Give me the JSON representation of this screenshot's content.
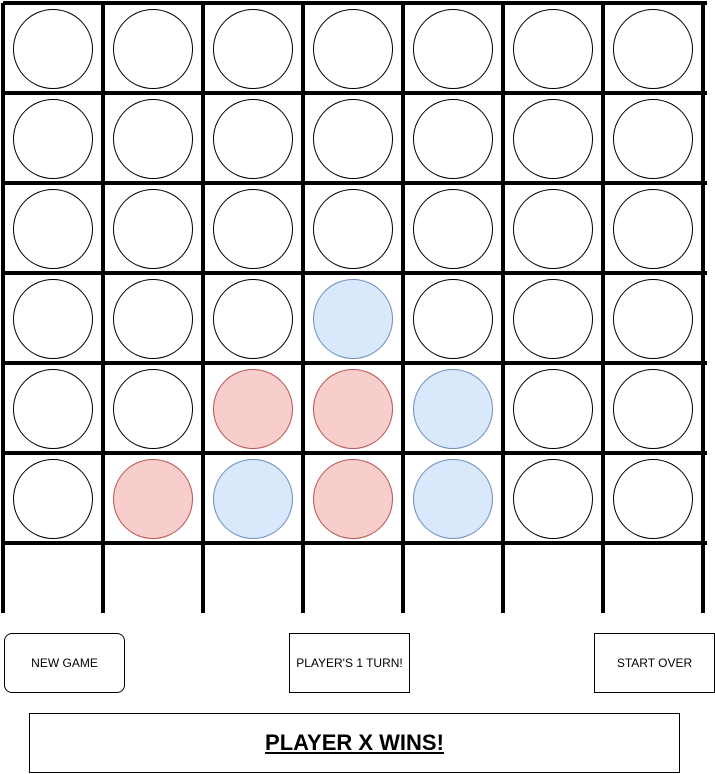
{
  "buttons": {
    "new_game": "NEW GAME",
    "turn": "PLAYER'S 1 TURN!",
    "start_over": "START OVER"
  },
  "status": "PLAYER X WINS!",
  "colors": {
    "red_fill": "#f8cecc",
    "red_stroke": "#b85450",
    "blue_fill": "#dae8fc",
    "blue_stroke": "#6c8ebf",
    "empty_fill": "#ffffff"
  },
  "board": {
    "columns": 7,
    "rows": 6,
    "cells": [
      [
        "empty",
        "empty",
        "empty",
        "empty",
        "empty",
        "empty",
        "empty"
      ],
      [
        "empty",
        "empty",
        "empty",
        "empty",
        "empty",
        "empty",
        "empty"
      ],
      [
        "empty",
        "empty",
        "empty",
        "empty",
        "empty",
        "empty",
        "empty"
      ],
      [
        "empty",
        "empty",
        "empty",
        "blue",
        "empty",
        "empty",
        "empty"
      ],
      [
        "empty",
        "empty",
        "red",
        "red",
        "blue",
        "empty",
        "empty"
      ],
      [
        "empty",
        "red",
        "blue",
        "red",
        "blue",
        "empty",
        "empty"
      ]
    ]
  }
}
